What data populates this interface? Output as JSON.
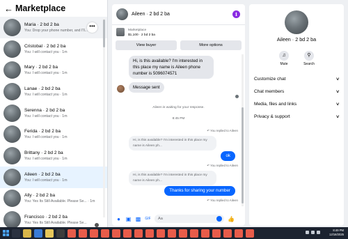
{
  "left": {
    "back_icon": "arrow-left-icon",
    "title": "Marketplace",
    "conversations": [
      {
        "name": "Maria · 2 bd 2 ba",
        "preview": "You: Drop your phone number, and I'll..."
      },
      {
        "name": "Cristobal · 2 bd 2 ba",
        "preview": "You: I will contact you · 1m"
      },
      {
        "name": "Mary · 2 bd 2 ba",
        "preview": "You: I will contact you · 1m"
      },
      {
        "name": "Lanae · 2 bd 2 ba",
        "preview": "You: I will contact you · 1m"
      },
      {
        "name": "Serenna · 2 bd 2 ba",
        "preview": "You: I will contact you · 1m"
      },
      {
        "name": "Ferida · 2 bd 2 ba",
        "preview": "You: I will contact you · 1m"
      },
      {
        "name": "Brittany · 2 bd 2 ba",
        "preview": "You: I will contact you · 1m"
      },
      {
        "name": "Aileen · 2 bd 2 ba",
        "preview": "You: I will contact you · 1m"
      },
      {
        "name": "Ally · 2 bd 2 ba",
        "preview": "You: Yes Its Still Available. Please Se... · 1m"
      },
      {
        "name": "Francisco · 2 bd 2 ba",
        "preview": "You: Yes Its Still Available. Please Se..."
      }
    ],
    "more_icon": "more-horizontal-icon"
  },
  "chat": {
    "name": "Aileen · 2 bd 2 ba",
    "info_icon": "info-icon",
    "listing_label": "Marketplace",
    "listing_detail": "$1,100 · 2 bd 2 ba",
    "view_buyer": "View buyer",
    "more_options": "More options",
    "msg_in_1": "Hi, is this available? I'm interested in this place my name is Aileen phone number is 5096074571",
    "msg_in_2": "Message sent",
    "waiting": "Aileen is waiting for your response.",
    "time": "8:45 PM",
    "replied_1": "You replied to Aileen",
    "quote_1": "Hi, is this available? I'm interested in this place my name is Aileen ph...",
    "out_1": "ok",
    "replied_2": "You replied to Aileen",
    "quote_2": "Hi, is this available? I'm interested in this place my name is Aileen ph...",
    "out_2": "Thanks for sharing your number",
    "replied_3": "You replied to Aileen",
    "placeholder": "Aa",
    "icons": [
      "mic-icon",
      "image-icon",
      "sticker-icon",
      "gif-icon",
      "emoji-icon",
      "like-icon"
    ]
  },
  "info": {
    "name": "Aileen · 2 bd 2 ba",
    "mute": "Mute",
    "search": "Search",
    "sections": [
      "Customize chat",
      "Chat members",
      "Media, files and links",
      "Privacy & support"
    ]
  },
  "taskbar": {
    "time": "8:49 PM",
    "date": "12/16/2025"
  },
  "colors": {
    "accent": "#0866ff",
    "info": "#8a2be2",
    "active_row": "#e7f3ff",
    "taskbar": "#1c2330"
  }
}
